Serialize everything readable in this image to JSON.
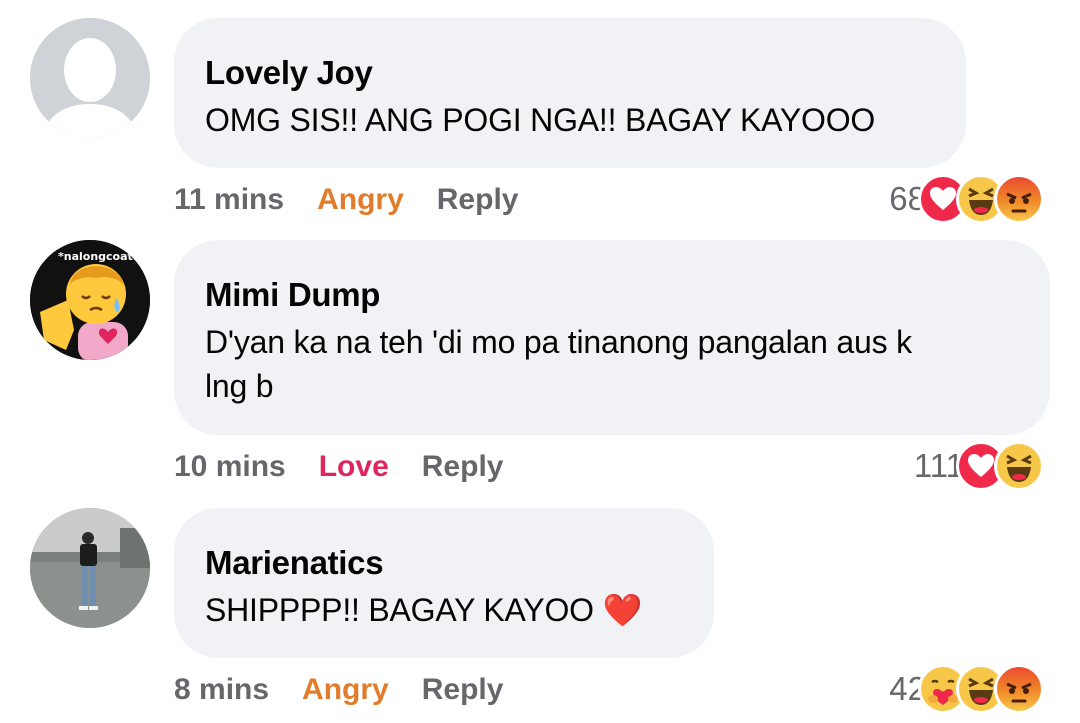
{
  "comments": [
    {
      "author": "Lovely Joy",
      "text": "OMG SIS!! ANG POGI NGA!! BAGAY KAYOOO",
      "time": "11 mins",
      "reaction_label": "Angry",
      "reply_label": "Reply",
      "reaction_count": "68",
      "reactions": [
        "love-icon",
        "haha-icon",
        "angry-icon"
      ]
    },
    {
      "author": "Mimi Dump",
      "text_line1": "D'yan ka na teh 'di mo pa tinanong pangalan aus k",
      "text_line2": "lng b",
      "time": "10 mins",
      "reaction_label": "Love",
      "reply_label": "Reply",
      "reaction_count": "111",
      "reactions": [
        "love-icon",
        "haha-icon"
      ],
      "avatar_sticker_text": "*nalongcoat"
    },
    {
      "author": "Marienatics",
      "text": "SHIPPPP!! BAGAY KAYOO",
      "text_emoji": "❤️",
      "time": "8 mins",
      "reaction_label": "Angry",
      "reply_label": "Reply",
      "reaction_count": "42",
      "reactions": [
        "care-icon",
        "haha-icon",
        "angry-icon"
      ]
    }
  ],
  "colors": {
    "bubble": "#f0f2f5",
    "meta": "#65676b",
    "angry": "#e17c2b",
    "love": "#e0245e"
  }
}
